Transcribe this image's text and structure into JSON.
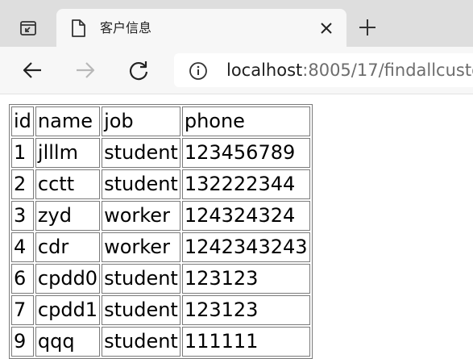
{
  "browser": {
    "tab": {
      "title": "客户信息"
    },
    "address": {
      "host": "localhost",
      "rest": ":8005/17/findallcusto"
    }
  },
  "icons": {
    "tab_actions": "tab-actions-icon",
    "tab_page": "page-icon",
    "tab_close": "close-icon",
    "new_tab": "plus-icon",
    "back": "back-arrow-icon",
    "forward": "forward-arrow-icon",
    "reload": "reload-icon",
    "site_info": "info-icon"
  },
  "table": {
    "columns": [
      "id",
      "name",
      "job",
      "phone"
    ],
    "rows": [
      [
        "1",
        "jlllm",
        "student",
        "123456789"
      ],
      [
        "2",
        "cctt",
        "student",
        "132222344"
      ],
      [
        "3",
        "zyd",
        "worker",
        "124324324"
      ],
      [
        "4",
        "cdr",
        "worker",
        "1242343243"
      ],
      [
        "6",
        "cpdd0",
        "student",
        "123123"
      ],
      [
        "7",
        "cpdd1",
        "student",
        "123123"
      ],
      [
        "9",
        "qqq",
        "student",
        "111111"
      ]
    ]
  }
}
